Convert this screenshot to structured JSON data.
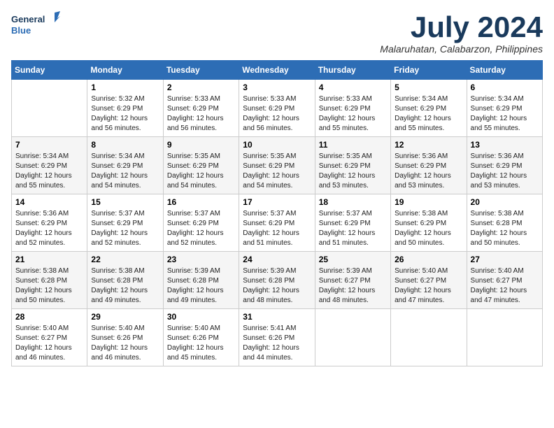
{
  "header": {
    "logo_line1": "General",
    "logo_line2": "Blue",
    "month_year": "July 2024",
    "location": "Malaruhatan, Calabarzon, Philippines"
  },
  "days_of_week": [
    "Sunday",
    "Monday",
    "Tuesday",
    "Wednesday",
    "Thursday",
    "Friday",
    "Saturday"
  ],
  "weeks": [
    [
      {
        "day": "",
        "info": ""
      },
      {
        "day": "1",
        "info": "Sunrise: 5:32 AM\nSunset: 6:29 PM\nDaylight: 12 hours\nand 56 minutes."
      },
      {
        "day": "2",
        "info": "Sunrise: 5:33 AM\nSunset: 6:29 PM\nDaylight: 12 hours\nand 56 minutes."
      },
      {
        "day": "3",
        "info": "Sunrise: 5:33 AM\nSunset: 6:29 PM\nDaylight: 12 hours\nand 56 minutes."
      },
      {
        "day": "4",
        "info": "Sunrise: 5:33 AM\nSunset: 6:29 PM\nDaylight: 12 hours\nand 55 minutes."
      },
      {
        "day": "5",
        "info": "Sunrise: 5:34 AM\nSunset: 6:29 PM\nDaylight: 12 hours\nand 55 minutes."
      },
      {
        "day": "6",
        "info": "Sunrise: 5:34 AM\nSunset: 6:29 PM\nDaylight: 12 hours\nand 55 minutes."
      }
    ],
    [
      {
        "day": "7",
        "info": "Sunrise: 5:34 AM\nSunset: 6:29 PM\nDaylight: 12 hours\nand 55 minutes."
      },
      {
        "day": "8",
        "info": "Sunrise: 5:34 AM\nSunset: 6:29 PM\nDaylight: 12 hours\nand 54 minutes."
      },
      {
        "day": "9",
        "info": "Sunrise: 5:35 AM\nSunset: 6:29 PM\nDaylight: 12 hours\nand 54 minutes."
      },
      {
        "day": "10",
        "info": "Sunrise: 5:35 AM\nSunset: 6:29 PM\nDaylight: 12 hours\nand 54 minutes."
      },
      {
        "day": "11",
        "info": "Sunrise: 5:35 AM\nSunset: 6:29 PM\nDaylight: 12 hours\nand 53 minutes."
      },
      {
        "day": "12",
        "info": "Sunrise: 5:36 AM\nSunset: 6:29 PM\nDaylight: 12 hours\nand 53 minutes."
      },
      {
        "day": "13",
        "info": "Sunrise: 5:36 AM\nSunset: 6:29 PM\nDaylight: 12 hours\nand 53 minutes."
      }
    ],
    [
      {
        "day": "14",
        "info": "Sunrise: 5:36 AM\nSunset: 6:29 PM\nDaylight: 12 hours\nand 52 minutes."
      },
      {
        "day": "15",
        "info": "Sunrise: 5:37 AM\nSunset: 6:29 PM\nDaylight: 12 hours\nand 52 minutes."
      },
      {
        "day": "16",
        "info": "Sunrise: 5:37 AM\nSunset: 6:29 PM\nDaylight: 12 hours\nand 52 minutes."
      },
      {
        "day": "17",
        "info": "Sunrise: 5:37 AM\nSunset: 6:29 PM\nDaylight: 12 hours\nand 51 minutes."
      },
      {
        "day": "18",
        "info": "Sunrise: 5:37 AM\nSunset: 6:29 PM\nDaylight: 12 hours\nand 51 minutes."
      },
      {
        "day": "19",
        "info": "Sunrise: 5:38 AM\nSunset: 6:29 PM\nDaylight: 12 hours\nand 50 minutes."
      },
      {
        "day": "20",
        "info": "Sunrise: 5:38 AM\nSunset: 6:28 PM\nDaylight: 12 hours\nand 50 minutes."
      }
    ],
    [
      {
        "day": "21",
        "info": "Sunrise: 5:38 AM\nSunset: 6:28 PM\nDaylight: 12 hours\nand 50 minutes."
      },
      {
        "day": "22",
        "info": "Sunrise: 5:38 AM\nSunset: 6:28 PM\nDaylight: 12 hours\nand 49 minutes."
      },
      {
        "day": "23",
        "info": "Sunrise: 5:39 AM\nSunset: 6:28 PM\nDaylight: 12 hours\nand 49 minutes."
      },
      {
        "day": "24",
        "info": "Sunrise: 5:39 AM\nSunset: 6:28 PM\nDaylight: 12 hours\nand 48 minutes."
      },
      {
        "day": "25",
        "info": "Sunrise: 5:39 AM\nSunset: 6:27 PM\nDaylight: 12 hours\nand 48 minutes."
      },
      {
        "day": "26",
        "info": "Sunrise: 5:40 AM\nSunset: 6:27 PM\nDaylight: 12 hours\nand 47 minutes."
      },
      {
        "day": "27",
        "info": "Sunrise: 5:40 AM\nSunset: 6:27 PM\nDaylight: 12 hours\nand 47 minutes."
      }
    ],
    [
      {
        "day": "28",
        "info": "Sunrise: 5:40 AM\nSunset: 6:27 PM\nDaylight: 12 hours\nand 46 minutes."
      },
      {
        "day": "29",
        "info": "Sunrise: 5:40 AM\nSunset: 6:26 PM\nDaylight: 12 hours\nand 46 minutes."
      },
      {
        "day": "30",
        "info": "Sunrise: 5:40 AM\nSunset: 6:26 PM\nDaylight: 12 hours\nand 45 minutes."
      },
      {
        "day": "31",
        "info": "Sunrise: 5:41 AM\nSunset: 6:26 PM\nDaylight: 12 hours\nand 44 minutes."
      },
      {
        "day": "",
        "info": ""
      },
      {
        "day": "",
        "info": ""
      },
      {
        "day": "",
        "info": ""
      }
    ]
  ]
}
